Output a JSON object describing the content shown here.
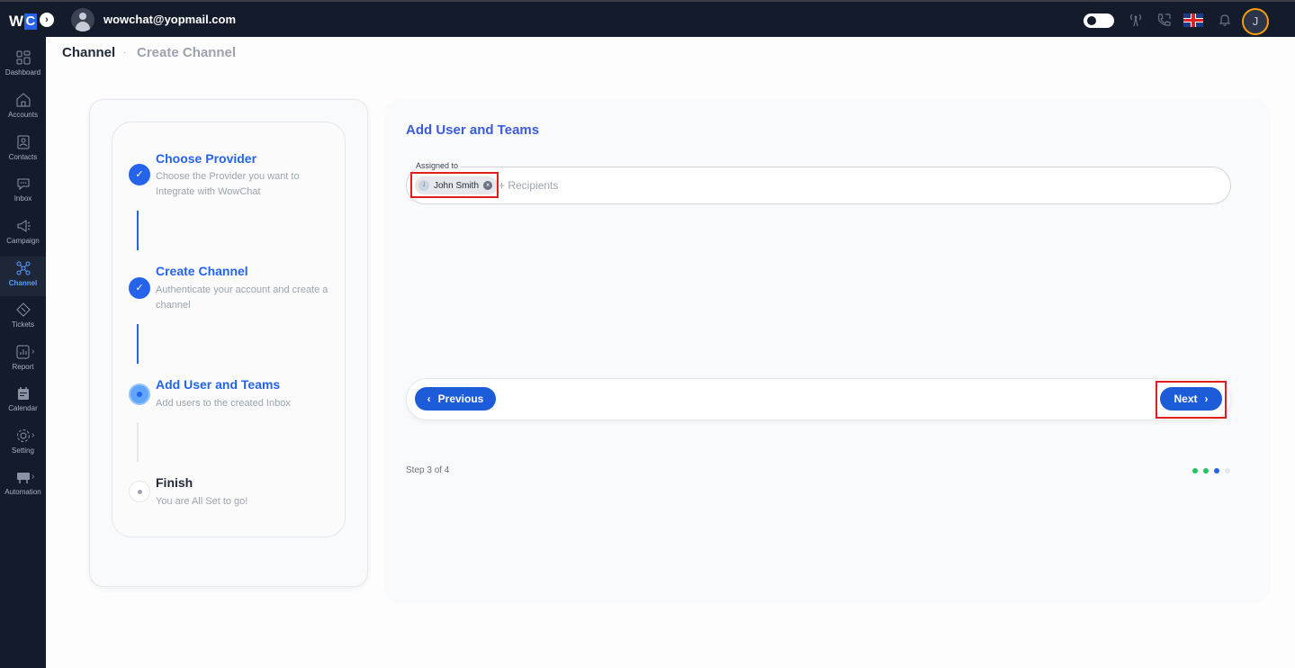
{
  "topbar": {
    "logo_w": "W",
    "logo_c": "C",
    "logo_toggle": "›",
    "user_email": "wowchat@yopmail.com",
    "avatar_initial": "J",
    "icons": [
      "theme-toggle",
      "antenna-icon",
      "phone-icon",
      "uk-flag-icon",
      "bell-icon"
    ]
  },
  "sidebar": {
    "items": [
      {
        "label": "Dashboard",
        "icon": "dashboard-icon"
      },
      {
        "label": "Accounts",
        "icon": "home-icon"
      },
      {
        "label": "Contacts",
        "icon": "contact-icon"
      },
      {
        "label": "Inbox",
        "icon": "inbox-icon"
      },
      {
        "label": "Campaign",
        "icon": "megaphone-icon"
      },
      {
        "label": "Channel",
        "icon": "channel-icon",
        "active": true
      },
      {
        "label": "Tickets",
        "icon": "ticket-icon"
      },
      {
        "label": "Report",
        "icon": "report-icon"
      },
      {
        "label": "Calendar",
        "icon": "calendar-icon"
      },
      {
        "label": "Setting",
        "icon": "gear-icon"
      },
      {
        "label": "Automation",
        "icon": "automation-icon"
      }
    ]
  },
  "breadcrumb": {
    "root": "Channel",
    "separator": "·",
    "current": "Create Channel"
  },
  "steps": [
    {
      "title": "Choose Provider",
      "desc": "Choose the Provider you want to Integrate with WowChat",
      "status": "done"
    },
    {
      "title": "Create Channel",
      "desc": "Authenticate your account and create a channel",
      "status": "done"
    },
    {
      "title": "Add User and Teams",
      "desc": "Add users to the created Inbox",
      "status": "current"
    },
    {
      "title": "Finish",
      "desc": "You are All Set to go!",
      "status": "pending"
    }
  ],
  "panel": {
    "title": "Add User and Teams",
    "assigned_label": "Assigned to",
    "chip_name": "John Smith",
    "chip_initial": "J",
    "recipients_placeholder": "+ Recipients",
    "previous_label": "Previous",
    "next_label": "Next",
    "step_count": "Step 3 of 4"
  },
  "colors": {
    "accent": "#2563eb",
    "sidebar_bg": "#141b2b",
    "highlight_red": "#e11d1d",
    "dot_done": "#22c55e",
    "dot_current": "#2563eb",
    "dot_pending": "#e5e7eb"
  }
}
